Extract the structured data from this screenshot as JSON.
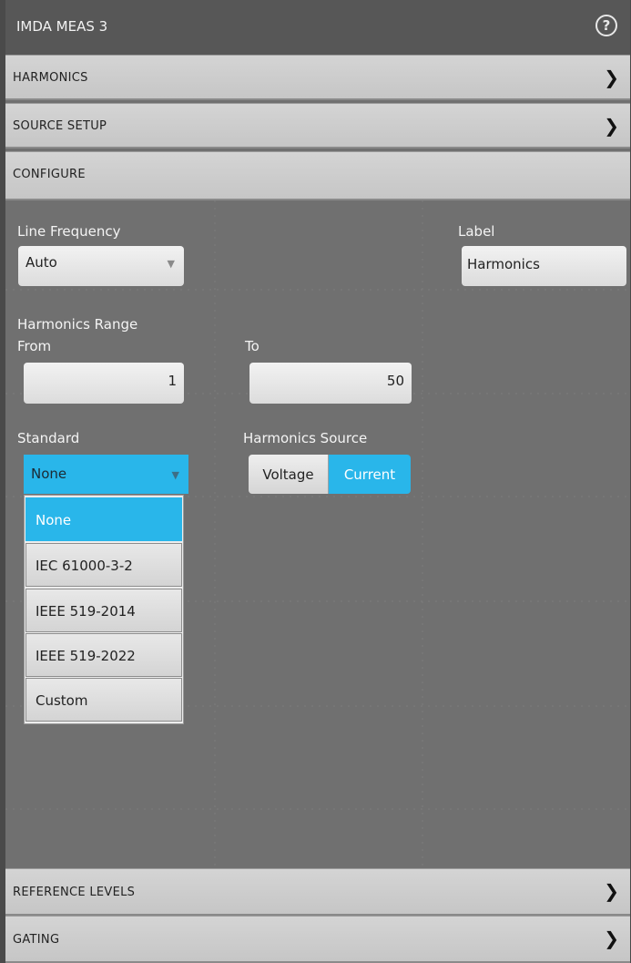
{
  "window": {
    "title": "IMDA MEAS 3",
    "help_icon": "question-circle-icon"
  },
  "sections": {
    "harmonics": "HARMONICS",
    "source_setup": "SOURCE SETUP",
    "configure": "CONFIGURE",
    "reference_levels": "REFERENCE LEVELS",
    "gating": "GATING"
  },
  "configure": {
    "line_frequency": {
      "label": "Line Frequency",
      "value": "Auto"
    },
    "label_field": {
      "label": "Label",
      "value": "Harmonics"
    },
    "harmonics_range": {
      "label": "Harmonics Range",
      "from_label": "From",
      "from_value": "1",
      "to_label": "To",
      "to_value": "50"
    },
    "standard": {
      "label": "Standard",
      "value": "None",
      "options": [
        "None",
        "IEC 61000-3-2",
        "IEEE 519-2014",
        "IEEE 519-2022",
        "Custom"
      ],
      "selected": "None"
    },
    "harmonics_source": {
      "label": "Harmonics Source",
      "options": [
        "Voltage",
        "Current"
      ],
      "selected": "Current"
    }
  },
  "colors": {
    "accent": "#29b6ea",
    "panel": "#707070",
    "titlebar": "#575757"
  }
}
